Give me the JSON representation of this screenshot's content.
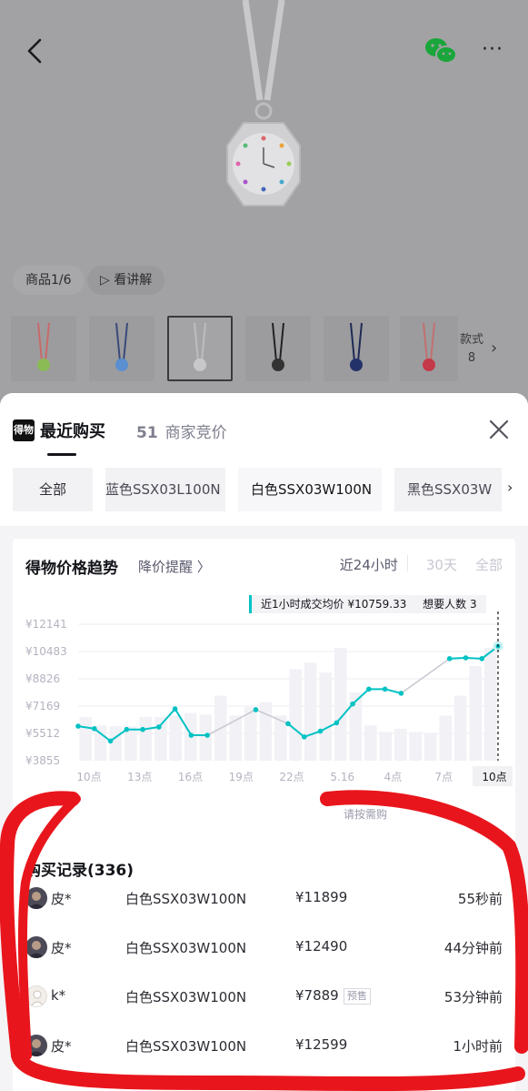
{
  "header": {
    "back_icon": "chevron-left-icon",
    "share_icon": "wechat-icon",
    "more_icon": "more-dots-icon",
    "more_label": "···"
  },
  "gallery": {
    "page_indicator": "商品1/6",
    "video_label": "看讲解",
    "style_label": "款式",
    "style_count": "8"
  },
  "sheet": {
    "logo_text": "得物",
    "tab_recent": "最近购买",
    "bid_count": "51",
    "bid_label": "商家竞价"
  },
  "variants": {
    "all": "全部",
    "blue": "蓝色SSX03L100N",
    "white": "白色SSX03W100N",
    "black": "黑色SSX03W"
  },
  "trend": {
    "title": "得物价格趋势",
    "alert_label": "降价提醒 〉",
    "range_24h": "近24小时",
    "range_30d": "30天",
    "range_all": "全部",
    "avg_label": "近1小时成交均价 ¥10759.33",
    "want_label": "想要人数 3",
    "hint": "请按需购"
  },
  "chart_data": {
    "type": "line",
    "y_ticks": [
      "¥12141",
      "¥10483",
      "¥8826",
      "¥7169",
      "¥5512",
      "¥3855"
    ],
    "x_ticks": [
      "10点",
      "13点",
      "16点",
      "19点",
      "22点",
      "5.16",
      "4点",
      "7点",
      "10点"
    ],
    "ylim": [
      3855,
      12141
    ],
    "series": [
      {
        "values": [
          5950,
          5800,
          5050,
          5750,
          5750,
          5900,
          7000,
          5400,
          5400,
          null,
          null,
          6950,
          null,
          6100,
          5300,
          5650,
          6150,
          7300,
          8200,
          8200,
          7950,
          null,
          null,
          10050,
          10100,
          10050,
          10800
        ]
      }
    ],
    "bars": [
      6500,
      6000,
      5950,
      5950,
      6500,
      6500,
      6600,
      6750,
      6650,
      7800,
      6600,
      7100,
      7400,
      6600,
      9400,
      9800,
      9200,
      10700,
      8000,
      6000,
      5600,
      5800,
      5600,
      5500,
      6600,
      7800,
      9600,
      10700
    ],
    "accent": "#00c2c3",
    "bar_color": "#f1f1f6"
  },
  "history": {
    "title": "购买记录(336)",
    "rows": [
      {
        "user": "皮*",
        "sku": "白色SSX03W100N",
        "price": "¥11899",
        "tag": "",
        "time": "55秒前"
      },
      {
        "user": "皮*",
        "sku": "白色SSX03W100N",
        "price": "¥12490",
        "tag": "",
        "time": "44分钟前"
      },
      {
        "user": "k*",
        "sku": "白色SSX03W100N",
        "price": "¥7889",
        "tag": "预售",
        "time": "53分钟前"
      },
      {
        "user": "皮*",
        "sku": "白色SSX03W100N",
        "price": "¥12599",
        "tag": "",
        "time": "1小时前"
      }
    ]
  }
}
